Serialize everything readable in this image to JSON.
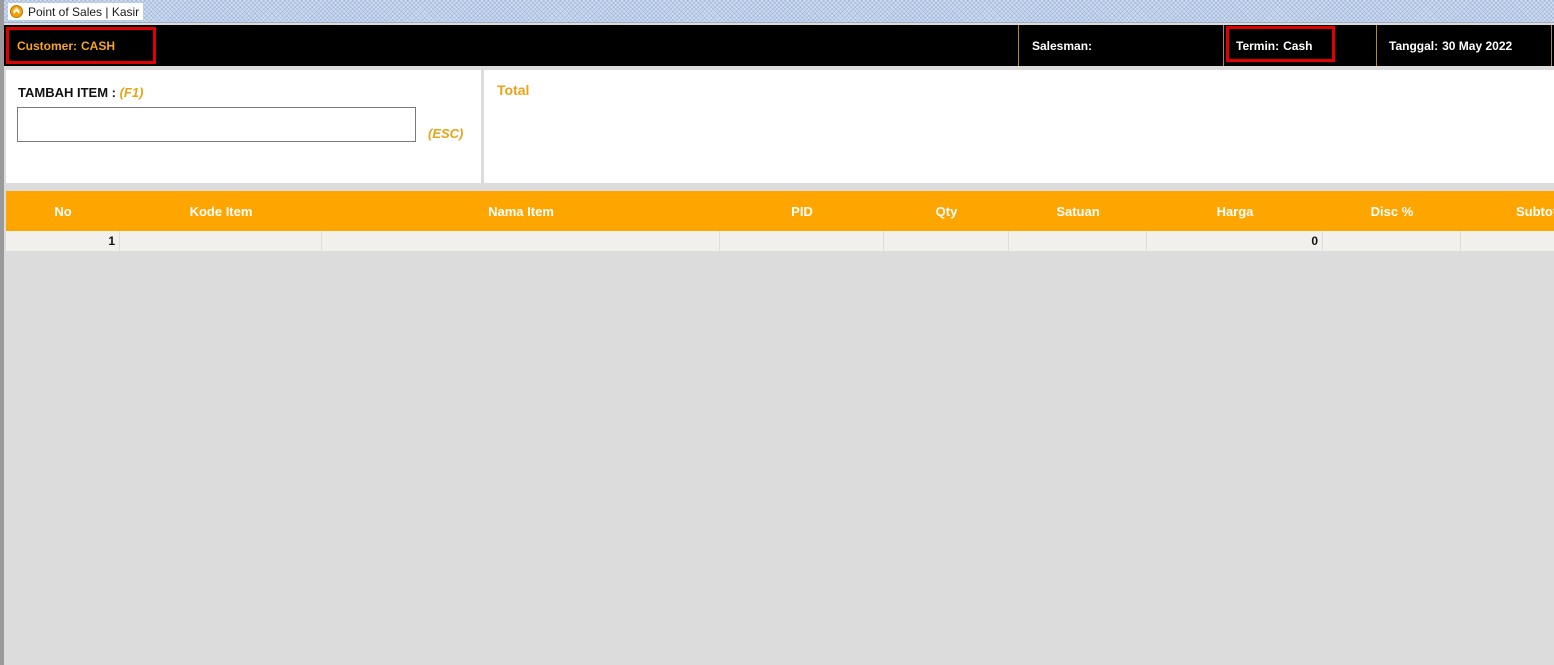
{
  "window": {
    "title": "Point of Sales | Kasir"
  },
  "header": {
    "customer": {
      "label": "Customer:",
      "value": "CASH"
    },
    "salesman": {
      "label": "Salesman:",
      "value": ""
    },
    "termin": {
      "label": "Termin:",
      "value": "Cash"
    },
    "tanggal": {
      "label": "Tanggal:",
      "value": "30 May 2022"
    }
  },
  "add_item": {
    "label": "TAMBAH ITEM :",
    "shortcut": "(F1)",
    "input_value": "",
    "esc_hint": "(ESC)"
  },
  "total": {
    "label": "Total"
  },
  "grid": {
    "columns": [
      "No",
      "Kode Item",
      "Nama Item",
      "PID",
      "Qty",
      "Satuan",
      "Harga",
      "Disc %",
      "Subtotal"
    ],
    "rows": [
      {
        "no": "1",
        "kode_item": "",
        "nama_item": "",
        "pid": "",
        "qty": "",
        "satuan": "",
        "harga": "0",
        "disc": "",
        "subtotal": ""
      }
    ]
  },
  "colors": {
    "accent": "#ffa500",
    "label_orange": "#e8a317",
    "header_bg": "#000000",
    "highlight": "#e00000"
  }
}
